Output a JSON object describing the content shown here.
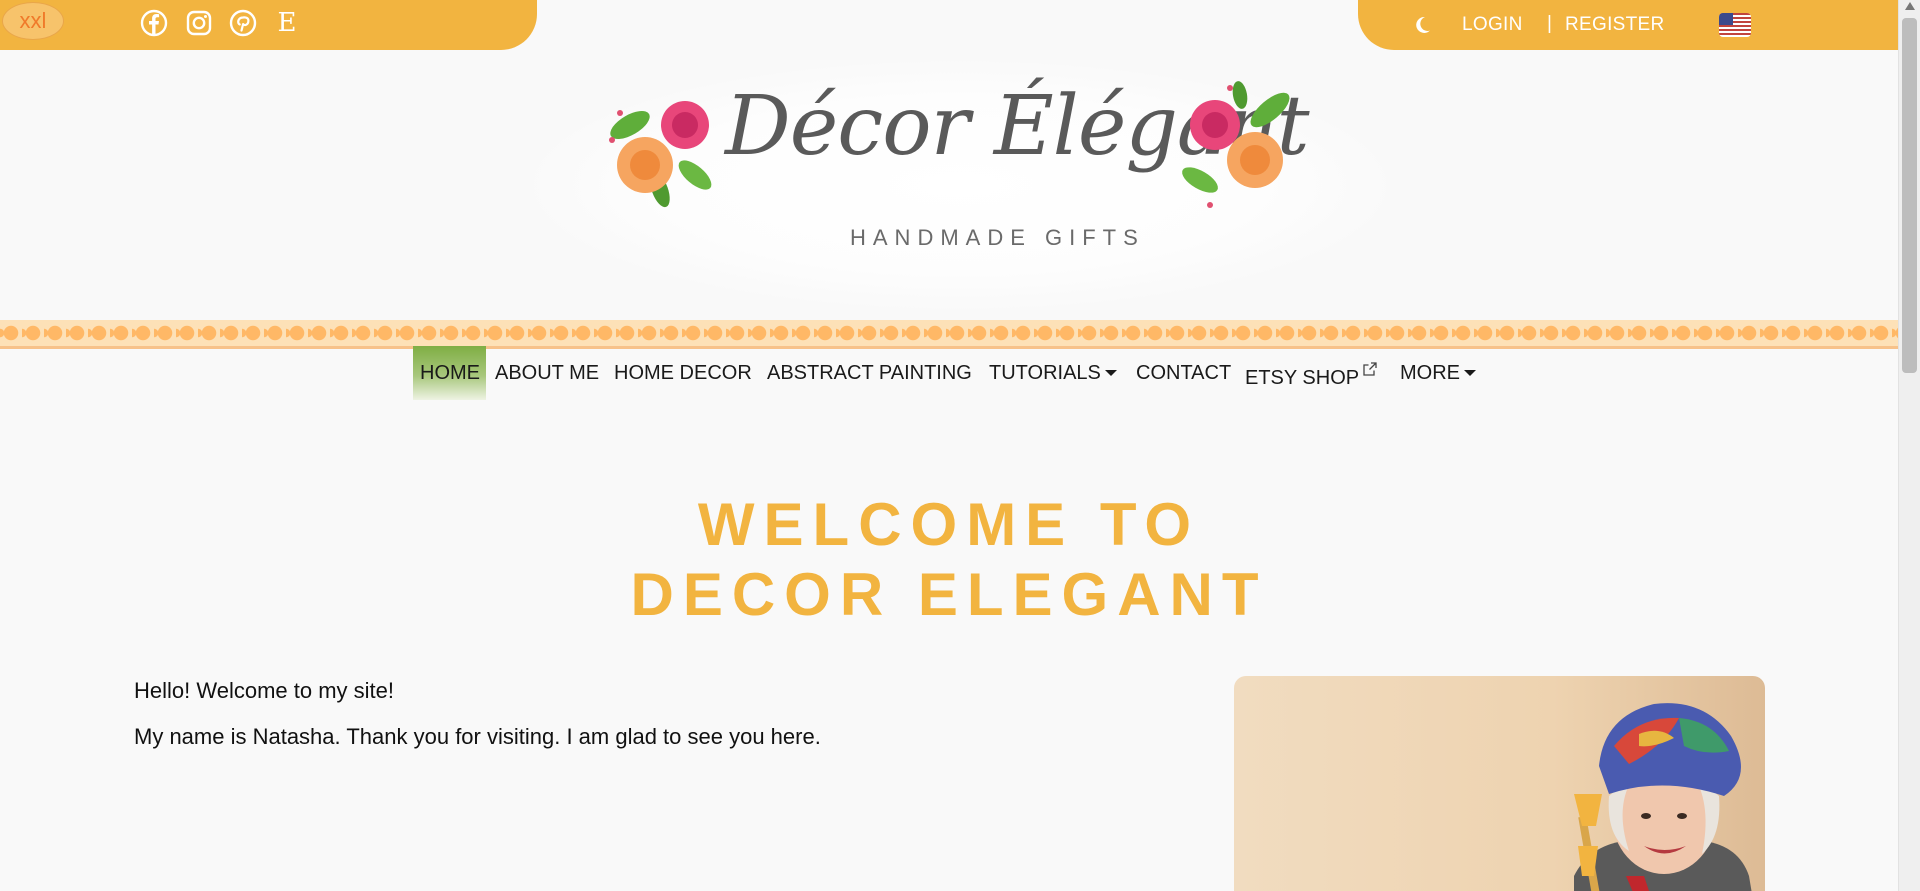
{
  "topbar": {
    "text_size_label": "xxl",
    "social": [
      {
        "name": "facebook-icon"
      },
      {
        "name": "instagram-icon"
      },
      {
        "name": "pinterest-icon"
      },
      {
        "name": "etsy-icon",
        "glyph": "E"
      }
    ],
    "theme_icon": "moon-icon",
    "login_label": "LOGIN",
    "separator": "|",
    "register_label": "REGISTER",
    "language_icon": "us-flag-icon"
  },
  "logo": {
    "title": "Décor Élégant",
    "subtitle": "HANDMADE GIFTS"
  },
  "nav": {
    "items": [
      {
        "label": "HOME",
        "active": true
      },
      {
        "label": "ABOUT ME"
      },
      {
        "label": "HOME DECOR"
      },
      {
        "label": "ABSTRACT PAINTING"
      },
      {
        "label": "TUTORIALS",
        "dropdown": true
      },
      {
        "label": "CONTACT"
      },
      {
        "label": "ETSY SHOP",
        "external": true
      },
      {
        "label": "MORE",
        "dropdown": true
      }
    ]
  },
  "main": {
    "headline_line1": "WELCOME TO",
    "headline_line2": "DECOR ELEGANT",
    "paragraph1": "Hello! Welcome to my site!",
    "paragraph2": "My name is Natasha. Thank you for visiting. I am glad to see you here."
  },
  "colors": {
    "accent": "#f2b440",
    "nav_active": "#7fae44",
    "strip": "#ffb866",
    "background": "#f9f9f9"
  }
}
